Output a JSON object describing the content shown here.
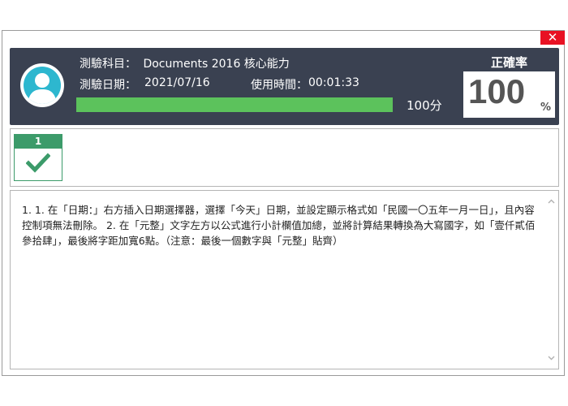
{
  "window": {
    "close_glyph": "✕"
  },
  "header": {
    "subject_label": "測驗科目：",
    "subject_value": "Documents 2016 核心能力",
    "date_label": "測驗日期：",
    "date_value": "2021/07/16",
    "time_label": "使用時間：",
    "time_value": "00:01:33",
    "progress_percent": 100,
    "score_text": "100分",
    "accuracy_title": "正確率",
    "accuracy_value": "100",
    "accuracy_unit": "%",
    "progress_color": "#5cc25c",
    "header_bg": "#3a4151"
  },
  "questions": {
    "items": [
      {
        "number": "1",
        "status": "correct"
      }
    ]
  },
  "content": {
    "text": "1. 1. 在「日期：」右方插入日期選擇器，選擇「今天」日期，並設定顯示格式如「民國一〇五年一月一日」，且內容控制項無法刪除。 2. 在「元整」文字左方以公式進行小計欄值加總，並將計算結果轉換為大寫國字，如「壹仟貳佰參拾肆」，最後將字距加寬6點。（注意：最後一個數字與「元整」貼齊）"
  },
  "icons": {
    "close": "close-icon",
    "avatar": "user-avatar-icon",
    "check": "check-icon",
    "scroll_up": "chevron-up-icon",
    "scroll_down": "chevron-down-icon"
  }
}
